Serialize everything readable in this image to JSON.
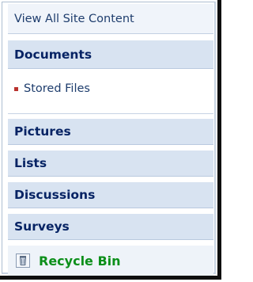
{
  "quick_launch": {
    "view_all": "View All Site Content",
    "sections": {
      "documents": "Documents",
      "pictures": "Pictures",
      "lists": "Lists",
      "discussions": "Discussions",
      "surveys": "Surveys"
    },
    "documents_items": [
      "Stored Files"
    ],
    "recycle_bin": "Recycle Bin"
  },
  "colors": {
    "header_background": "#d8e3f1",
    "header_text": "#062364",
    "link_text": "#1e3d6d",
    "bullet": "#b9322e",
    "recycle_text": "#0c8f1a",
    "frame_border": "#0f0f0f"
  },
  "icons": {
    "bullet": "square-bullet-icon",
    "recycle": "recycle-bin-icon"
  }
}
